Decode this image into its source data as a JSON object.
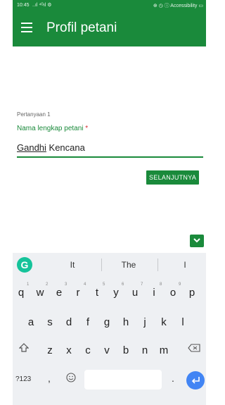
{
  "status_bar": {
    "time": "10:45",
    "signal": "..ıl ⁴ᴳıl ⚙",
    "right": "⊕ ◷ ⓘ Accessibility ▭"
  },
  "app_bar": {
    "title": "Profil petani",
    "menu_icon": "hamburger-menu-icon"
  },
  "question": {
    "number_label": "Pertanyaan 1",
    "label": "Nama lengkap petani",
    "required_mark": "*",
    "answer_first": "Gandhi",
    "answer_rest": " Kencana"
  },
  "next_button": "SELANJUTNYA",
  "scroll_button_icon": "chevron-down-icon",
  "keyboard": {
    "suggestions": [
      "It",
      "The",
      "I"
    ],
    "row1": [
      "q",
      "w",
      "e",
      "r",
      "t",
      "y",
      "u",
      "i",
      "o",
      "p"
    ],
    "row1_hints": [
      "1",
      "2",
      "3",
      "4",
      "5",
      "6",
      "7",
      "8",
      "9",
      ""
    ],
    "row2": [
      "a",
      "s",
      "d",
      "f",
      "g",
      "h",
      "j",
      "k",
      "l"
    ],
    "row3": [
      "z",
      "x",
      "c",
      "v",
      "b",
      "n",
      "m"
    ],
    "symbols_key": "?123",
    "comma_key": ",",
    "period_key": ".",
    "emoji_icon": "emoji-icon",
    "shift_icon": "shift-icon",
    "backspace_icon": "backspace-icon",
    "enter_icon": "enter-icon"
  },
  "colors": {
    "primary": "#1a8a3b",
    "required": "#d32f2f",
    "keyboard_bg": "#eef0f3",
    "enter": "#4285f4",
    "grammarly": "#15c39a"
  }
}
